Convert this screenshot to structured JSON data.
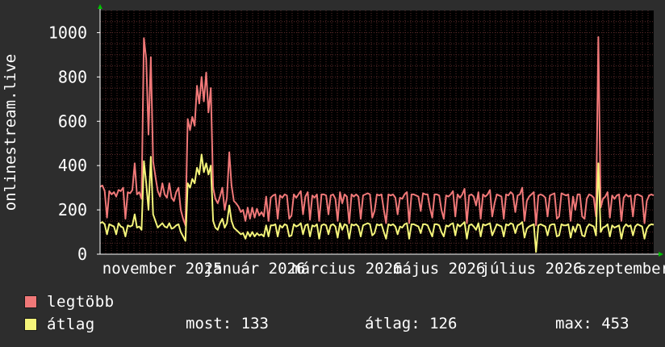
{
  "chart_data": {
    "type": "line",
    "ylabel": "onlinestream.live",
    "ylim": [
      0,
      1100
    ],
    "y_ticks": [
      "0",
      "200",
      "400",
      "600",
      "800",
      "1000"
    ],
    "x_ticks": [
      "november 2025",
      "január 2026",
      "március 2026",
      "május 2026",
      "július 2026",
      "szeptember"
    ],
    "grid": true,
    "series": [
      {
        "name": "legtöbb",
        "color": "#f07878",
        "values": [
          305,
          310,
          285,
          165,
          285,
          270,
          280,
          260,
          290,
          285,
          300,
          160,
          280,
          275,
          290,
          410,
          270,
          280,
          250,
          975,
          880,
          540,
          890,
          420,
          350,
          285,
          260,
          320,
          270,
          255,
          320,
          255,
          240,
          280,
          300,
          200,
          160,
          130,
          610,
          560,
          620,
          580,
          760,
          680,
          800,
          690,
          820,
          640,
          750,
          300,
          250,
          230,
          260,
          300,
          200,
          255,
          460,
          310,
          240,
          230,
          215,
          190,
          200,
          150,
          210,
          160,
          210,
          165,
          205,
          175,
          190,
          170,
          260,
          150,
          255,
          265,
          270,
          160,
          265,
          255,
          270,
          265,
          160,
          175,
          270,
          255,
          270,
          285,
          180,
          260,
          280,
          155,
          265,
          255,
          270,
          150,
          270,
          270,
          265,
          180,
          265,
          270,
          250,
          150,
          280,
          230,
          270,
          260,
          140,
          270,
          260,
          270,
          260,
          160,
          265,
          270,
          275,
          270,
          165,
          195,
          270,
          265,
          270,
          200,
          140,
          270,
          265,
          270,
          255,
          180,
          255,
          250,
          270,
          280,
          140,
          270,
          270,
          265,
          260,
          195,
          275,
          270,
          270,
          210,
          165,
          270,
          270,
          265,
          200,
          160,
          265,
          260,
          270,
          285,
          170,
          270,
          255,
          270,
          295,
          140,
          265,
          270,
          260,
          220,
          280,
          160,
          270,
          260,
          270,
          290,
          170,
          230,
          270,
          265,
          260,
          160,
          270,
          265,
          280,
          270,
          190,
          265,
          270,
          300,
          150,
          240,
          260,
          270,
          280,
          130,
          265,
          270,
          265,
          255,
          170,
          265,
          270,
          275,
          160,
          170,
          275,
          270,
          265,
          270,
          150,
          260,
          200,
          270,
          270,
          170,
          160,
          250,
          270,
          265,
          255,
          170,
          980,
          210,
          250,
          260,
          280,
          165,
          265,
          250,
          265,
          270,
          150,
          255,
          270,
          260,
          265,
          170,
          265,
          270,
          265,
          260,
          140,
          240,
          265,
          270,
          265
        ]
      },
      {
        "name": "átlag",
        "color": "#f4f47a",
        "values": [
          140,
          145,
          135,
          90,
          135,
          130,
          125,
          90,
          140,
          125,
          120,
          80,
          130,
          125,
          130,
          180,
          120,
          125,
          110,
          420,
          320,
          200,
          440,
          180,
          150,
          120,
          130,
          140,
          125,
          120,
          140,
          115,
          120,
          130,
          135,
          100,
          80,
          60,
          320,
          300,
          340,
          320,
          390,
          360,
          450,
          370,
          410,
          360,
          400,
          150,
          120,
          110,
          140,
          160,
          120,
          140,
          220,
          150,
          120,
          110,
          100,
          90,
          95,
          70,
          100,
          80,
          100,
          80,
          95,
          85,
          90,
          80,
          130,
          80,
          130,
          130,
          135,
          80,
          130,
          120,
          135,
          130,
          80,
          85,
          135,
          125,
          130,
          140,
          90,
          130,
          135,
          80,
          130,
          125,
          135,
          70,
          130,
          135,
          130,
          90,
          130,
          135,
          125,
          75,
          140,
          110,
          135,
          130,
          70,
          135,
          130,
          135,
          125,
          80,
          130,
          135,
          140,
          135,
          85,
          95,
          135,
          130,
          135,
          100,
          70,
          135,
          130,
          135,
          125,
          90,
          125,
          120,
          135,
          140,
          70,
          135,
          135,
          130,
          125,
          95,
          135,
          135,
          130,
          105,
          80,
          135,
          135,
          130,
          100,
          80,
          130,
          125,
          135,
          140,
          85,
          135,
          125,
          135,
          145,
          70,
          130,
          135,
          125,
          110,
          140,
          80,
          135,
          130,
          135,
          140,
          85,
          110,
          135,
          130,
          125,
          80,
          135,
          130,
          140,
          135,
          95,
          130,
          135,
          145,
          75,
          115,
          125,
          130,
          135,
          10,
          130,
          135,
          130,
          125,
          85,
          130,
          135,
          135,
          80,
          85,
          135,
          130,
          130,
          135,
          75,
          125,
          100,
          135,
          130,
          85,
          80,
          120,
          135,
          130,
          125,
          85,
          410,
          100,
          120,
          125,
          135,
          80,
          130,
          120,
          125,
          130,
          70,
          120,
          135,
          125,
          130,
          85,
          125,
          135,
          130,
          125,
          70,
          115,
          130,
          135,
          133
        ]
      }
    ]
  },
  "legend": {
    "max_label": "legtöbb",
    "avg_label": "átlag",
    "now_text": "most: 133",
    "avg_text": "átlag: 126",
    "max_text": "max: 453"
  },
  "colors": {
    "background": "#2d2d2d",
    "plot_background": "#000000",
    "grid": "#5a2a2a",
    "axis": "#ffffff",
    "arrow": "#00c000"
  }
}
